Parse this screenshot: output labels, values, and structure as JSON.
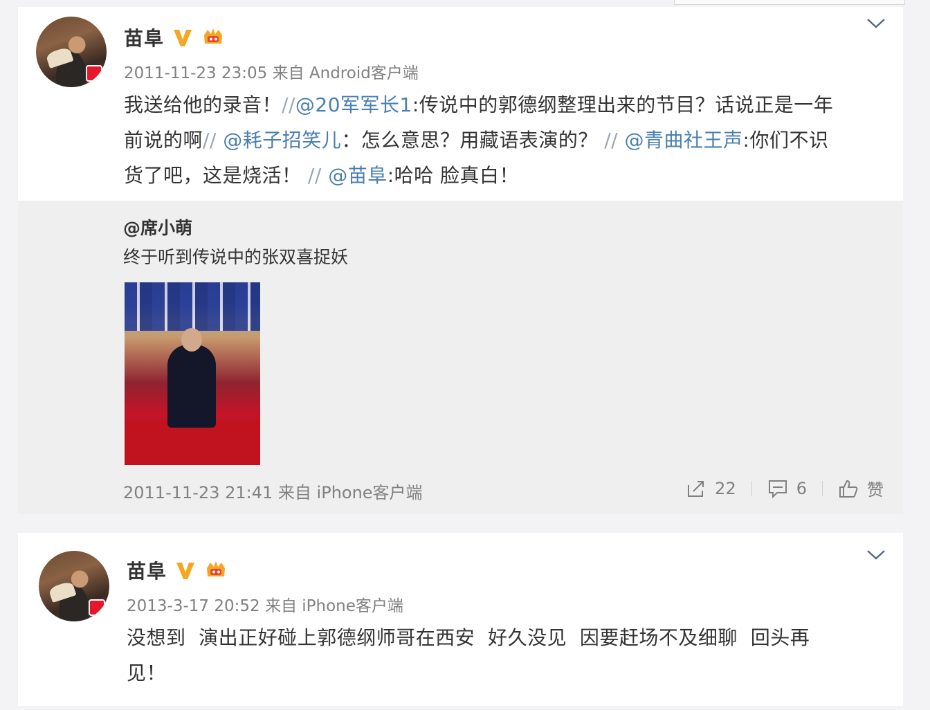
{
  "posts": [
    {
      "user_name": "苗阜",
      "timestamp": "2011-11-23 23:05",
      "source": "来自 Android客户端",
      "text": {
        "l1a": "我送给他的录音！",
        "l1sep": "//",
        "l1m": "@20军军长1",
        "l1b": ":传说中的郭德纲整理出来的节目？话说正是一年",
        "l2a": "前说的啊",
        "l2sep": "//",
        "l2m": "@耗子招笑儿",
        "l2b": "：怎么意思？用藏语表演的？",
        "l2sep2": "//",
        "l2m2": "@青曲社王声",
        "l2c": ":你们不识",
        "l3a": "货了吧，这是烧活！",
        "l3sep": "//",
        "l3m": "@苗阜",
        "l3b": ":哈哈 脸真白！"
      },
      "repost": {
        "user": "@席小萌",
        "text": "终于听到传说中的张双喜捉妖",
        "timestamp": "2011-11-23 21:41",
        "source": "来自 iPhone客户端",
        "share_count": "22",
        "comment_count": "6",
        "like_label": "赞"
      }
    },
    {
      "user_name": "苗阜",
      "timestamp": "2013-3-17 20:52",
      "source": "来自 iPhone客户端",
      "text": {
        "l1": "没想到  演出正好碰上郭德纲师哥在西安  好久没见  因要赶场不及细聊  回头再",
        "l2": "见！"
      }
    }
  ],
  "colors": {
    "mention": "#4a7fb1",
    "verified": "#f5a623",
    "meta": "#808080"
  },
  "icons": [
    "verified-v-icon",
    "crown-icon",
    "chevron-down-icon",
    "share-icon",
    "comment-icon",
    "like-icon"
  ]
}
